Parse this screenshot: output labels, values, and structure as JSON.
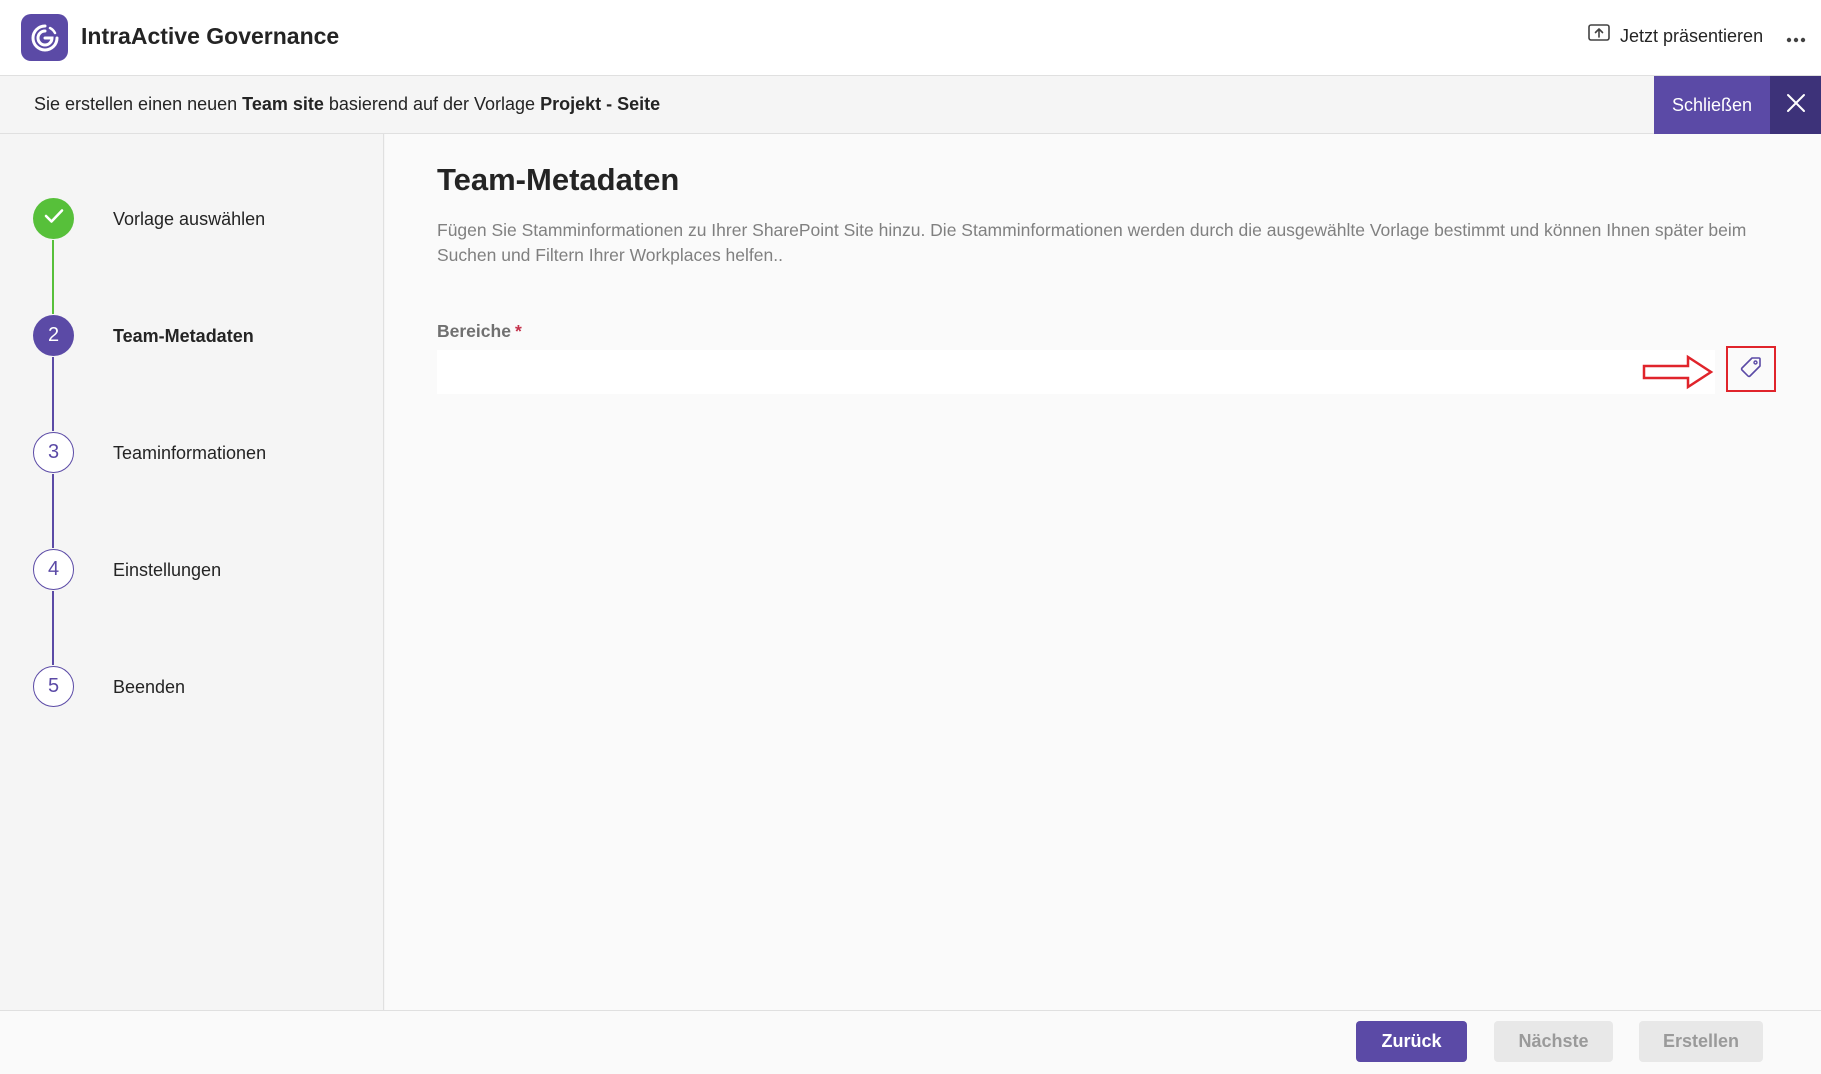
{
  "header": {
    "app_title": "IntraActive Governance",
    "present_label": "Jetzt präsentieren",
    "more_icon": "more-horizontal-icon",
    "logo_icon": "governance-logo-icon"
  },
  "info_bar": {
    "prefix": "Sie erstellen einen neuen",
    "site_type": "Team site",
    "middle": "basierend auf der Vorlage",
    "template": "Projekt - Seite",
    "close_label": "Schließen"
  },
  "steps": [
    {
      "number": "",
      "label": "Vorlage auswählen",
      "state": "done"
    },
    {
      "number": "2",
      "label": "Team-Metadaten",
      "state": "active"
    },
    {
      "number": "3",
      "label": "Teaminformationen",
      "state": "todo"
    },
    {
      "number": "4",
      "label": "Einstellungen",
      "state": "todo"
    },
    {
      "number": "5",
      "label": "Beenden",
      "state": "todo"
    }
  ],
  "main": {
    "title": "Team-Metadaten",
    "description": "Fügen Sie Stamminformationen zu Ihrer SharePoint Site hinzu. Die Stamminformationen werden durch die ausgewählte Vorlage bestimmt und können Ihnen später beim Suchen und Filtern Ihrer Workplaces helfen..",
    "field": {
      "label": "Bereiche",
      "required_mark": "*",
      "value": "",
      "placeholder": ""
    }
  },
  "footer": {
    "back_label": "Zurück",
    "next_label": "Nächste",
    "create_label": "Erstellen"
  },
  "colors": {
    "brand": "#5b4aa6",
    "brand_dark": "#3d3279",
    "success": "#57c03a",
    "annotation": "#e0242b"
  }
}
